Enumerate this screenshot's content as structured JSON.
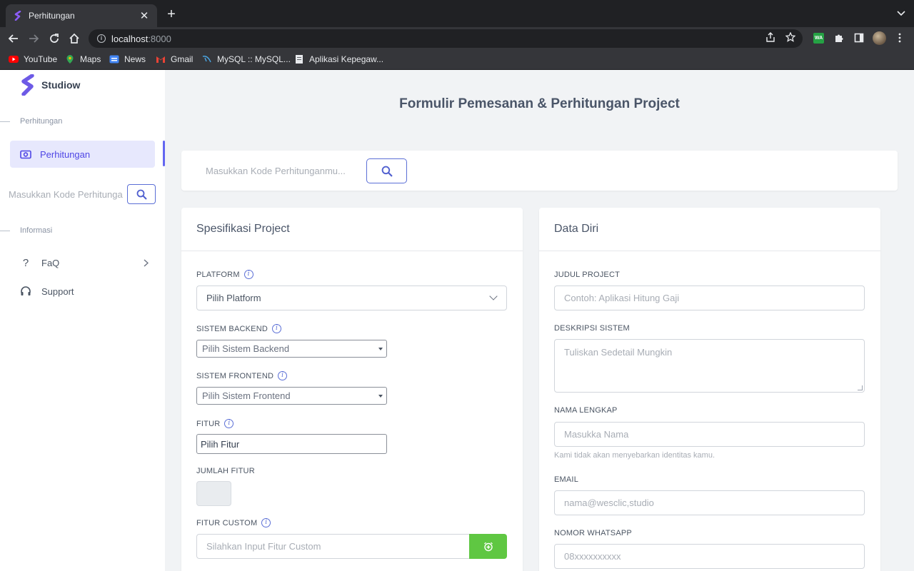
{
  "browser": {
    "tab_title": "Perhitungan",
    "url_host": "localhost",
    "url_port": ":8000",
    "bookmarks": [
      "YouTube",
      "Maps",
      "News",
      "Gmail",
      "MySQL :: MySQL...",
      "Aplikasi Kepegaw..."
    ]
  },
  "sidebar": {
    "brand": "Studiow",
    "section_calc": "Perhitungan",
    "active_item": "Perhitungan",
    "search_placeholder": "Masukkan Kode Perhitunganmu...",
    "section_info": "Informasi",
    "items": [
      "FaQ",
      "Support"
    ]
  },
  "main": {
    "title": "Formulir Pemesanan & Perhitungan Project",
    "search_placeholder": "Masukkan Kode Perhitunganmu..."
  },
  "spec": {
    "heading": "Spesifikasi Project",
    "platform_label": "PLATFORM",
    "platform_value": "Pilih Platform",
    "backend_label": "SISTEM BACKEND",
    "backend_value": "Pilih Sistem Backend",
    "frontend_label": "SISTEM FRONTEND",
    "frontend_value": "Pilih Sistem Frontend",
    "fitur_label": "FITUR",
    "fitur_value": "Pilih Fitur",
    "jumlah_label": "JUMLAH FITUR",
    "custom_label": "FITUR CUSTOM",
    "custom_placeholder": "Silahkan Input Fitur Custom"
  },
  "profile": {
    "heading": "Data Diri",
    "judul_label": "JUDUL PROJECT",
    "judul_placeholder": "Contoh: Aplikasi Hitung Gaji",
    "deskripsi_label": "DESKRIPSI SISTEM",
    "deskripsi_placeholder": "Tuliskan Sedetail Mungkin",
    "nama_label": "NAMA LENGKAP",
    "nama_placeholder": "Masukka Nama",
    "nama_help": "Kami tidak akan menyebarkan identitas kamu.",
    "email_label": "EMAIL",
    "email_placeholder": "nama@wesclic,studio",
    "wa_label": "NOMOR WHATSAPP",
    "wa_placeholder": "08xxxxxxxxxx"
  },
  "colors": {
    "accent": "#5b6fd6",
    "active_bg": "#e7e8fd",
    "green_button": "#5fc742"
  }
}
